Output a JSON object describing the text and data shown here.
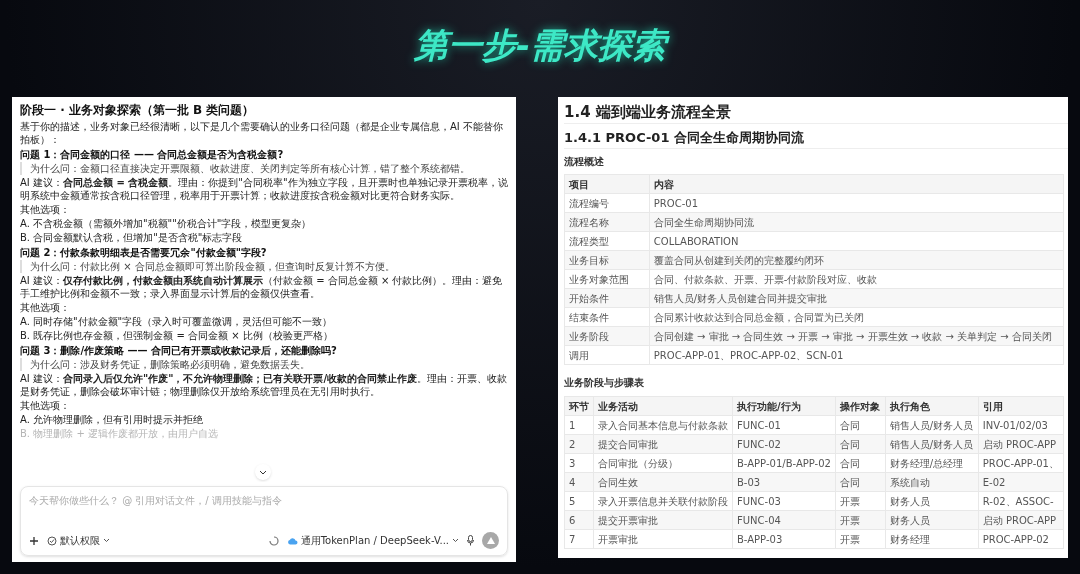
{
  "slide_title": "第一步-需求探索",
  "chat_panel": {
    "blocks": [
      {
        "kind": "heading",
        "text": "阶段一 · 业务对象探索（第一批 B 类问题）"
      },
      {
        "kind": "para",
        "text": "基于你的描述，业务对象已经很清晰，以下是几个需要确认的业务口径问题（都是企业专属信息，AI 不能替你拍板）："
      },
      {
        "kind": "question",
        "text": "问题 1：合同金额的口径 —— 合同总金额是否为含税金额?"
      },
      {
        "kind": "quote",
        "text": "为什么问：金额口径直接决定开票限额、收款进度、关闭判定等所有核心计算，错了整个系统都错。"
      },
      {
        "kind": "para",
        "text": "AI 建议：**合同总金额 = 含税金额**。理由：你提到\"合同税率\"作为独立字段，且开票时也单独记录开票税率，说明系统中金额通常按含税口径管理，税率用于开票计算；收款进度按含税金额对比更符合财务实际。"
      },
      {
        "kind": "options_label",
        "text": "其他选项："
      },
      {
        "kind": "option",
        "text": "A. 不含税金额（需额外增加\"税额\"\"价税合计\"字段，模型更复杂）",
        "faded": false
      },
      {
        "kind": "option",
        "text": "B. 合同金额默认含税，但增加\"是否含税\"标志字段",
        "faded": false
      },
      {
        "kind": "question",
        "text": "问题 2：付款条款明细表是否需要冗余\"付款金额\"字段?"
      },
      {
        "kind": "quote",
        "text": "为什么问：付款比例 × 合同总金额即可算出阶段金额，但查询时反复计算不方便。"
      },
      {
        "kind": "para",
        "text": "AI 建议：**仅存付款比例，付款金额由系统自动计算展示**（付款金额 = 合同总金额 × 付款比例）。理由：避免手工维护比例和金额不一致；录入界面显示计算后的金额仅供查看。"
      },
      {
        "kind": "options_label",
        "text": "其他选项："
      },
      {
        "kind": "option",
        "text": "A. 同时存储\"付款金额\"字段（录入时可覆盖微调，灵活但可能不一致）",
        "faded": false
      },
      {
        "kind": "option",
        "text": "B. 既存比例也存金额，但强制金额 = 合同金额 × 比例（校验更严格）",
        "faded": false
      },
      {
        "kind": "question",
        "text": "问题 3：删除/作废策略 —— 合同已有开票或收款记录后，还能删除吗?"
      },
      {
        "kind": "quote",
        "text": "为什么问：涉及财务凭证，删除策略必须明确，避免数据丢失。"
      },
      {
        "kind": "para",
        "text": "AI 建议：**合同录入后仅允许\"作废\"，不允许物理删除；已有关联开票/收款的合同禁止作废**。理由：开票、收款是财务凭证，删除会破坏审计链；物理删除仅开放给系统管理员在无引用时执行。"
      },
      {
        "kind": "options_label",
        "text": "其他选项："
      },
      {
        "kind": "option",
        "text": "A. 允许物理删除，但有引用时提示并拒绝",
        "faded": false
      },
      {
        "kind": "option",
        "text": "B. 物理删除 + 逻辑作废都开放，由用户自选",
        "faded": true
      }
    ],
    "input": {
      "placeholder": "今天帮你做些什么？ @ 引用对话文件，/ 调用技能与指令"
    },
    "permission_label": "默认权限",
    "model_label": "通用TokenPlan / DeepSeek-V..."
  },
  "doc_panel": {
    "title": "1.4 端到端业务流程全景",
    "subtitle": "1.4.1 PROC-01 合同全生命周期协同流",
    "overview_label": "流程概述",
    "overview_table": {
      "columns": [
        "项目",
        "内容"
      ],
      "rows": [
        [
          "流程编号",
          "PROC-01"
        ],
        [
          "流程名称",
          "合同全生命周期协同流"
        ],
        [
          "流程类型",
          "COLLABORATION"
        ],
        [
          "业务目标",
          "覆盖合同从创建到关闭的完整履约闭环"
        ],
        [
          "业务对象范围",
          "合同、付款条款、开票、开票-付款阶段对应、收款"
        ],
        [
          "开始条件",
          "销售人员/财务人员创建合同并提交审批"
        ],
        [
          "结束条件",
          "合同累计收款达到合同总金额，合同置为已关闭"
        ],
        [
          "业务阶段",
          "合同创建 → 审批 → 合同生效 → 开票 → 审批 → 开票生效 → 收款 → 关单判定 → 合同关闭"
        ],
        [
          "调用",
          "PROC-APP-01、PROC-APP-02、SCN-01"
        ]
      ]
    },
    "steps_label": "业务阶段与步骤表",
    "steps_table": {
      "columns": [
        "环节",
        "业务活动",
        "执行功能/行为",
        "操作对象",
        "执行角色",
        "引用"
      ],
      "rows": [
        [
          "1",
          "录入合同基本信息与付款条款",
          "FUNC-01",
          "合同",
          "销售人员/财务人员",
          "INV-01/02/03"
        ],
        [
          "2",
          "提交合同审批",
          "FUNC-02",
          "合同",
          "销售人员/财务人员",
          "启动 PROC-APP"
        ],
        [
          "3",
          "合同审批（分级）",
          "B-APP-01/B-APP-02",
          "合同",
          "财务经理/总经理",
          "PROC-APP-01、"
        ],
        [
          "4",
          "合同生效",
          "B-03",
          "合同",
          "系统自动",
          "E-02"
        ],
        [
          "5",
          "录入开票信息并关联付款阶段",
          "FUNC-03",
          "开票",
          "财务人员",
          "R-02、ASSOC-"
        ],
        [
          "6",
          "提交开票审批",
          "FUNC-04",
          "开票",
          "财务人员",
          "启动 PROC-APP"
        ],
        [
          "7",
          "开票审批",
          "B-APP-03",
          "开票",
          "财务经理",
          "PROC-APP-02"
        ]
      ]
    }
  }
}
